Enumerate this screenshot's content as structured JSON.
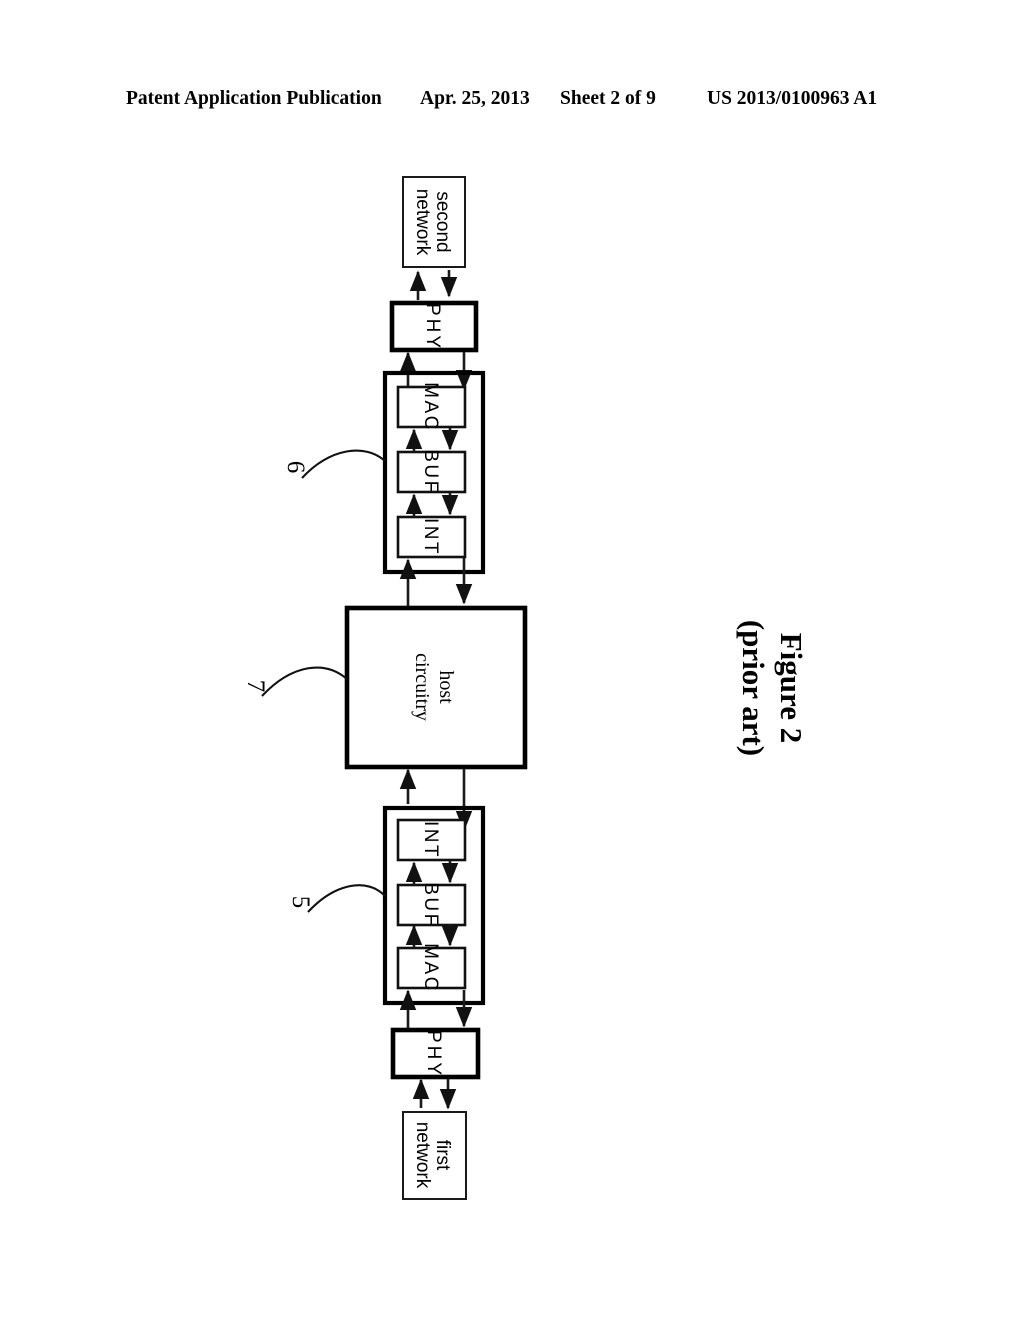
{
  "header": {
    "publication": "Patent Application Publication",
    "date": "Apr. 25, 2013",
    "sheet": "Sheet 2 of 9",
    "patent_number": "US 2013/0100963 A1"
  },
  "caption": {
    "line1": "Figure 2",
    "line2": "(prior art)"
  },
  "figure": {
    "blocks": {
      "second_network": "second\nnetwork",
      "second_network_l1": "second",
      "second_network_l2": "network",
      "first_network_l1": "first",
      "first_network_l2": "network",
      "phy_top": "PHY",
      "phy_bottom": "PHY",
      "host_l1": "host",
      "host_l2": "circuitry",
      "mac_top": "MAC",
      "buf_top": "BUF",
      "int_top": "INT",
      "int_bottom": "INT",
      "buf_bottom": "BUF",
      "mac_bottom": "MAC"
    },
    "reference_numerals": {
      "upper_group": "6",
      "host": "7",
      "lower_group": "5"
    }
  },
  "colors": {
    "ink": "#000000",
    "paper": "#ffffff"
  }
}
